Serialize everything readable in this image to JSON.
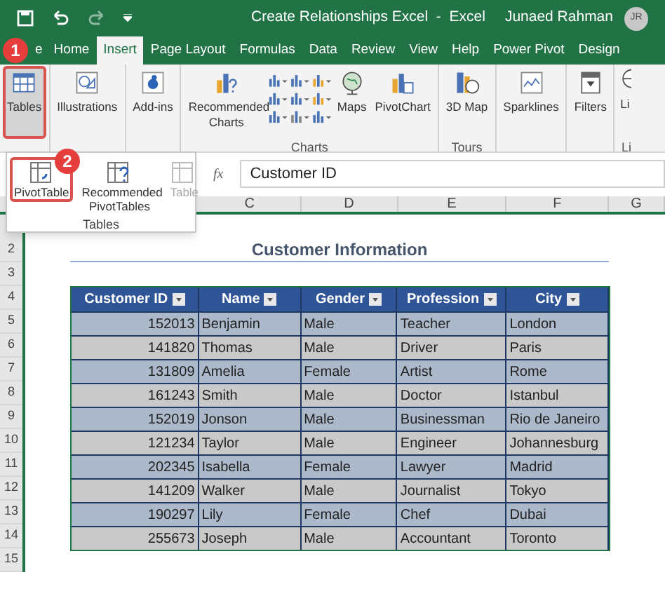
{
  "window": {
    "title": "Create Relationships Excel  -  Excel",
    "user": "Junaed Rahman",
    "avatar": "JR"
  },
  "step_badges": [
    "1",
    "2"
  ],
  "tabs": [
    {
      "label": "e",
      "selected": false
    },
    {
      "label": "Home",
      "selected": false
    },
    {
      "label": "Insert",
      "selected": true
    },
    {
      "label": "Page Layout",
      "selected": false
    },
    {
      "label": "Formulas",
      "selected": false
    },
    {
      "label": "Data",
      "selected": false
    },
    {
      "label": "Review",
      "selected": false
    },
    {
      "label": "View",
      "selected": false
    },
    {
      "label": "Help",
      "selected": false
    },
    {
      "label": "Power Pivot",
      "selected": false
    },
    {
      "label": "Design",
      "selected": false
    }
  ],
  "ribbon": {
    "groups": [
      {
        "buttons": [
          {
            "kind": "tables",
            "label": "Tables",
            "selected": true
          }
        ]
      },
      {
        "buttons": [
          {
            "kind": "illustrations",
            "label": "Illustrations",
            "selected": false
          }
        ]
      },
      {
        "buttons": [
          {
            "kind": "addins",
            "label": "Add-ins",
            "selected": false
          }
        ]
      },
      {
        "label": "Charts",
        "buttons": [
          {
            "kind": "reccharts",
            "label": "Recommended Charts",
            "selected": false
          },
          {
            "kind": "chartgrid"
          },
          {
            "kind": "maps",
            "label": "Maps",
            "selected": false
          },
          {
            "kind": "pivotchart",
            "label": "PivotChart",
            "selected": false
          }
        ]
      },
      {
        "label": "Tours",
        "buttons": [
          {
            "kind": "map3d",
            "label": "3D Map",
            "selected": false
          }
        ]
      },
      {
        "buttons": [
          {
            "kind": "sparklines",
            "label": "Sparklines",
            "selected": false
          }
        ]
      },
      {
        "buttons": [
          {
            "kind": "filters",
            "label": "Filters",
            "selected": false
          }
        ]
      },
      {
        "label": "Li",
        "buttons": [
          {
            "kind": "links",
            "label": "Li",
            "selected": false
          }
        ]
      }
    ]
  },
  "dropdown": {
    "group_label": "Tables",
    "items": [
      {
        "kind": "pivot",
        "label": "PivotTable",
        "selected": true,
        "disabled": false
      },
      {
        "kind": "recpivot",
        "label": "Recommended PivotTables",
        "selected": false,
        "disabled": false
      },
      {
        "kind": "table",
        "label": "Table",
        "selected": false,
        "disabled": true
      }
    ]
  },
  "formula_bar": {
    "fx": "fx",
    "value": "Customer ID"
  },
  "columns": [
    "C",
    "D",
    "E",
    "F",
    "G"
  ],
  "sheet": {
    "title": "Customer Information",
    "row_numbers": [
      "2",
      "3",
      "4",
      "5",
      "6",
      "7",
      "8",
      "9",
      "10",
      "11",
      "12",
      "13",
      "14",
      "15"
    ],
    "table": {
      "columns": [
        "Customer ID",
        "Name",
        "Gender",
        "Profession",
        "City"
      ],
      "rows": [
        [
          "152013",
          "Benjamin",
          "Male",
          "Teacher",
          "London"
        ],
        [
          "141820",
          "Thomas",
          "Male",
          "Driver",
          "Paris"
        ],
        [
          "131809",
          "Amelia",
          "Female",
          "Artist",
          "Rome"
        ],
        [
          "161243",
          "Smith",
          "Male",
          "Doctor",
          "Istanbul"
        ],
        [
          "152019",
          "Jonson",
          "Male",
          "Businessman",
          "Rio de Janeiro"
        ],
        [
          "121234",
          "Taylor",
          "Male",
          "Engineer",
          "Johannesburg"
        ],
        [
          "202345",
          "Isabella",
          "Female",
          "Lawyer",
          "Madrid"
        ],
        [
          "141209",
          "Walker",
          "Male",
          "Journalist",
          "Tokyo"
        ],
        [
          "190297",
          "Lily",
          "Female",
          "Chef",
          "Dubai"
        ],
        [
          "255673",
          "Joseph",
          "Male",
          "Accountant",
          "Toronto"
        ]
      ]
    }
  }
}
